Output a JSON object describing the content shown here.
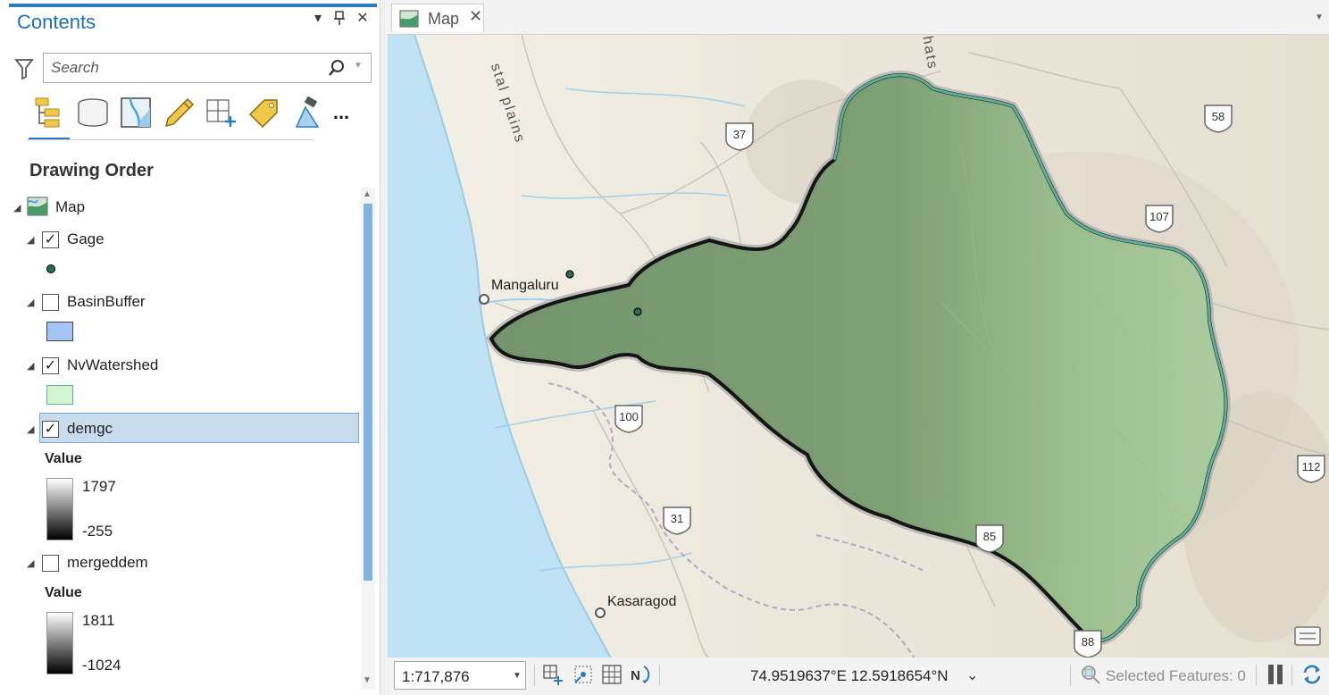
{
  "contents_pane": {
    "title": "Contents",
    "buttons": {
      "options": "▾",
      "pin": "⊥",
      "close": "✕"
    },
    "search": {
      "placeholder": "Search",
      "value": ""
    },
    "toolbar_tools": [
      "list-by-drawing-order",
      "list-by-data-source",
      "list-by-selection",
      "list-by-editing",
      "list-by-snapping",
      "list-by-labeling",
      "list-by-perspective-imagery",
      "more-options"
    ],
    "more_label": "...",
    "section_heading": "Drawing Order",
    "map_item": {
      "label": "Map"
    },
    "layers": [
      {
        "id": "gage",
        "label": "Gage",
        "checked": true,
        "symbol": "point",
        "symbol_color": "#2e6b5e"
      },
      {
        "id": "basinbuffer",
        "label": "BasinBuffer",
        "checked": false,
        "symbol": "polygon",
        "symbol_color": "#a3c4f5"
      },
      {
        "id": "nvwatershed",
        "label": "NvWatershed",
        "checked": true,
        "symbol": "polygon",
        "symbol_color": "#d5f5d1"
      },
      {
        "id": "demgc",
        "label": "demgc",
        "checked": true,
        "selected": true,
        "value_heading": "Value",
        "high": "1797",
        "low": "-255"
      },
      {
        "id": "mergeddem",
        "label": "mergeddem",
        "checked": false,
        "value_heading": "Value",
        "high": "1811",
        "low": "-1024"
      }
    ],
    "check_mark": "✓"
  },
  "map_view": {
    "tab_label": "Map",
    "tab_close": "✕",
    "places": [
      {
        "name": "Mangaluru"
      },
      {
        "name": "Kasaragod"
      }
    ],
    "geo_labels": [
      "stal plains",
      "hats"
    ],
    "route_shields": [
      "37",
      "58",
      "107",
      "100",
      "31",
      "85",
      "112",
      "88"
    ]
  },
  "status_bar": {
    "scale": "1:717,876",
    "coordinates": "74.9519637°E 12.5918654°N",
    "selected_features": "Selected Features: 0"
  },
  "colors": {
    "accent": "#2b7bc0",
    "selection_bg": "#c9dcee",
    "scroll_thumb": "#7fb4e3",
    "watershed_fill": "#6f9a6a",
    "sea": "#bfe3f5"
  }
}
